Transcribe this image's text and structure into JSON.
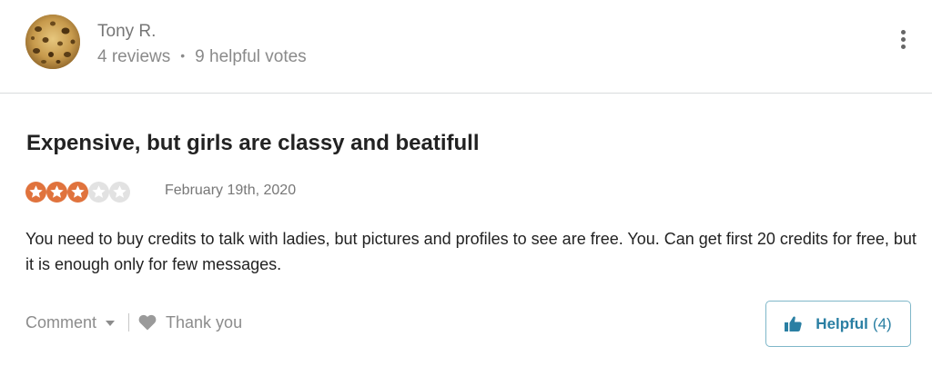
{
  "reviewer": {
    "name": "Tony R.",
    "reviews": "4 reviews",
    "separator": "•",
    "helpful_votes": "9 helpful votes",
    "avatar_icon": "user-avatar-photo"
  },
  "menu": {
    "icon": "more-vertical-icon"
  },
  "review": {
    "title": "Expensive, but girls are classy and beatifull",
    "rating": 3,
    "rating_max": 5,
    "date": "February 19th, 2020",
    "body": "You need to buy credits to talk with ladies, but pictures and profiles to see are free. You. Can get first 20 credits for free, but it is enough only for few messages."
  },
  "actions": {
    "comment_label": "Comment",
    "thank_label": "Thank you",
    "helpful_label": "Helpful",
    "helpful_count": "(4)"
  },
  "colors": {
    "star_on": "#e0733d",
    "star_off": "#e2e2e2",
    "helpful_accent": "#2a7fa3",
    "helpful_border": "#7fb7c9"
  }
}
